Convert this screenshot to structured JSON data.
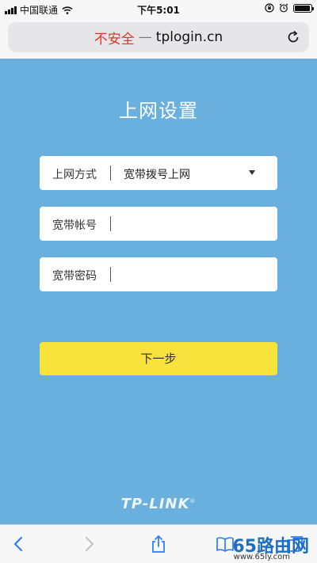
{
  "status_bar": {
    "carrier": "中国联通",
    "time": "下午5:01",
    "battery_level": 0.95
  },
  "browser": {
    "insecure_label": "不安全",
    "dash": "—",
    "domain": "tplogin.cn"
  },
  "page": {
    "title": "上网设置",
    "fields": [
      {
        "label": "上网方式",
        "value": "宽带拨号上网",
        "type": "select"
      },
      {
        "label": "宽带帐号",
        "value": "",
        "type": "text"
      },
      {
        "label": "宽带密码",
        "value": "",
        "type": "password"
      }
    ],
    "next_button": "下一步",
    "logo": "TP-LINK",
    "logo_reg": "®"
  },
  "watermark": {
    "text": "65路由网",
    "url": "www.65ly.com"
  },
  "colors": {
    "page_bg": "#6ab0de",
    "button": "#f7e33b",
    "insecure": "#e0342a",
    "toolbar_icon": "#2f7ff6"
  },
  "icons": {
    "reload": "reload-icon",
    "back": "back-icon",
    "forward": "forward-icon",
    "share": "share-icon",
    "bookmarks": "bookmarks-icon",
    "tabs": "tabs-icon"
  }
}
